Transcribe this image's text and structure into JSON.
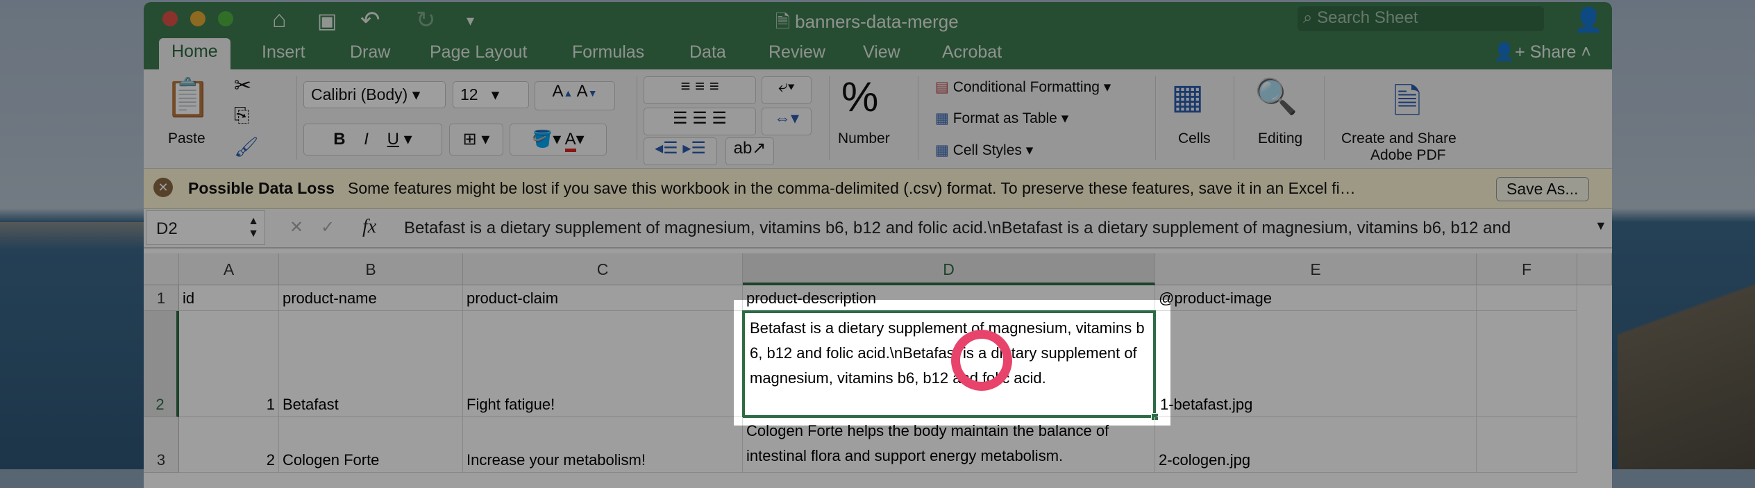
{
  "window": {
    "title": "banners-data-merge",
    "search_placeholder": "Search Sheet"
  },
  "tabs": [
    "Home",
    "Insert",
    "Draw",
    "Page Layout",
    "Formulas",
    "Data",
    "Review",
    "View",
    "Acrobat"
  ],
  "share_label": "Share",
  "ribbon": {
    "paste": "Paste",
    "font_name": "Calibri (Body)",
    "font_size": "12",
    "bold": "B",
    "italic": "I",
    "underline": "U",
    "number": "Number",
    "conditional_formatting": "Conditional Formatting",
    "format_as_table": "Format as Table",
    "cell_styles": "Cell Styles",
    "cells": "Cells",
    "editing": "Editing",
    "pdf_line1": "Create and Share",
    "pdf_line2": "Adobe PDF"
  },
  "message_bar": {
    "title": "Possible Data Loss",
    "text": "Some features might be lost if you save this workbook in the comma-delimited (.csv) format. To preserve these features, save it in an Excel fi…",
    "button": "Save As..."
  },
  "formula_bar": {
    "name_box": "D2",
    "fx": "fx",
    "content": "Betafast is a dietary supplement of magnesium, vitamins b6, b12 and folic acid.\\nBetafast is a dietary supplement of magnesium, vitamins b6, b12 and"
  },
  "columns": [
    "A",
    "B",
    "C",
    "D",
    "E",
    "F"
  ],
  "rows": [
    {
      "num": "1",
      "cells": [
        "id",
        "product-name",
        "product-claim",
        "product-description",
        "@product-image",
        ""
      ]
    },
    {
      "num": "2",
      "cells": [
        "1",
        "Betafast",
        "Fight fatigue!",
        "Betafast is a dietary supplement of magnesium, vitamins b6, b12 and folic acid.\\nBetafast is a dietary supplement of magnesium, vitamins b6, b12 and folic acid.",
        "1-betafast.jpg",
        ""
      ]
    },
    {
      "num": "3",
      "cells": [
        "2",
        "Cologen Forte",
        "Increase your metabolism!",
        "Cologen Forte helps the body maintain the balance of intestinal flora and support energy metabolism.",
        "2-cologen.jpg",
        ""
      ]
    }
  ],
  "colors": {
    "excel_green": "#3e7c51",
    "selection": "#2e6b45",
    "highlight_ring": "#e8436b"
  }
}
